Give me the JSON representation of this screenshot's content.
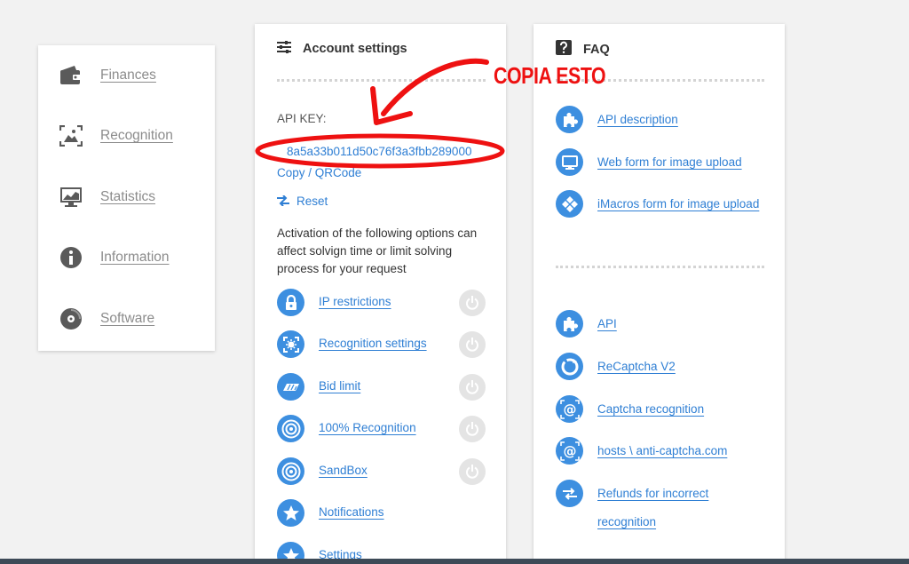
{
  "nav": {
    "items": [
      {
        "label": "Finances",
        "icon": "wallet-icon"
      },
      {
        "label": "Recognition",
        "icon": "image-recognition-icon"
      },
      {
        "label": "Statistics",
        "icon": "statistics-monitor-icon"
      },
      {
        "label": "Information",
        "icon": "info-icon"
      },
      {
        "label": "Software",
        "icon": "disc-icon"
      }
    ]
  },
  "account": {
    "title": "Account settings",
    "api_key_label": "API KEY:",
    "api_key_value": "8a5a33b011d50c76f3a3fbb289000",
    "copy_label": "Copy / QRCode",
    "reset_label": "Reset",
    "description": "Activation of the following options can affect solvign time or limit solving process for your request",
    "options": [
      {
        "label": "IP restrictions",
        "icon": "lock-icon",
        "toggle": true
      },
      {
        "label": "Recognition settings",
        "icon": "recognition-settings-icon",
        "toggle": true
      },
      {
        "label": "Bid limit",
        "icon": "bid-limit-icon",
        "toggle": true
      },
      {
        "label": "100% Recognition",
        "icon": "target-icon",
        "toggle": true
      },
      {
        "label": "SandBox",
        "icon": "target-icon",
        "toggle": true
      },
      {
        "label": "Notifications",
        "icon": "star-icon",
        "toggle": false
      },
      {
        "label": "Settings",
        "icon": "star-icon",
        "toggle": false
      }
    ]
  },
  "faq": {
    "title": "FAQ",
    "top_links": [
      {
        "label": "API description",
        "icon": "puzzle-icon"
      },
      {
        "label": "Web form for image upload",
        "icon": "monitor-icon"
      },
      {
        "label": "iMacros form for image upload",
        "icon": "imacros-icon"
      }
    ],
    "bottom_links": [
      {
        "label": "API",
        "icon": "puzzle-icon"
      },
      {
        "label": "ReCaptcha V2",
        "icon": "recaptcha-icon"
      },
      {
        "label": "Captcha recognition",
        "icon": "at-sign-icon"
      },
      {
        "label": "hosts \\ anti-captcha.com",
        "icon": "at-sign-icon"
      },
      {
        "label": "Refunds for incorrect recognition",
        "icon": "swap-arrows-icon"
      }
    ]
  },
  "annotation": {
    "text": "COPIA ESTO",
    "color": "#ee1111"
  },
  "colors": {
    "accent": "#3d8fe0",
    "link": "#2f7fd4",
    "background": "#f2f2f2"
  }
}
